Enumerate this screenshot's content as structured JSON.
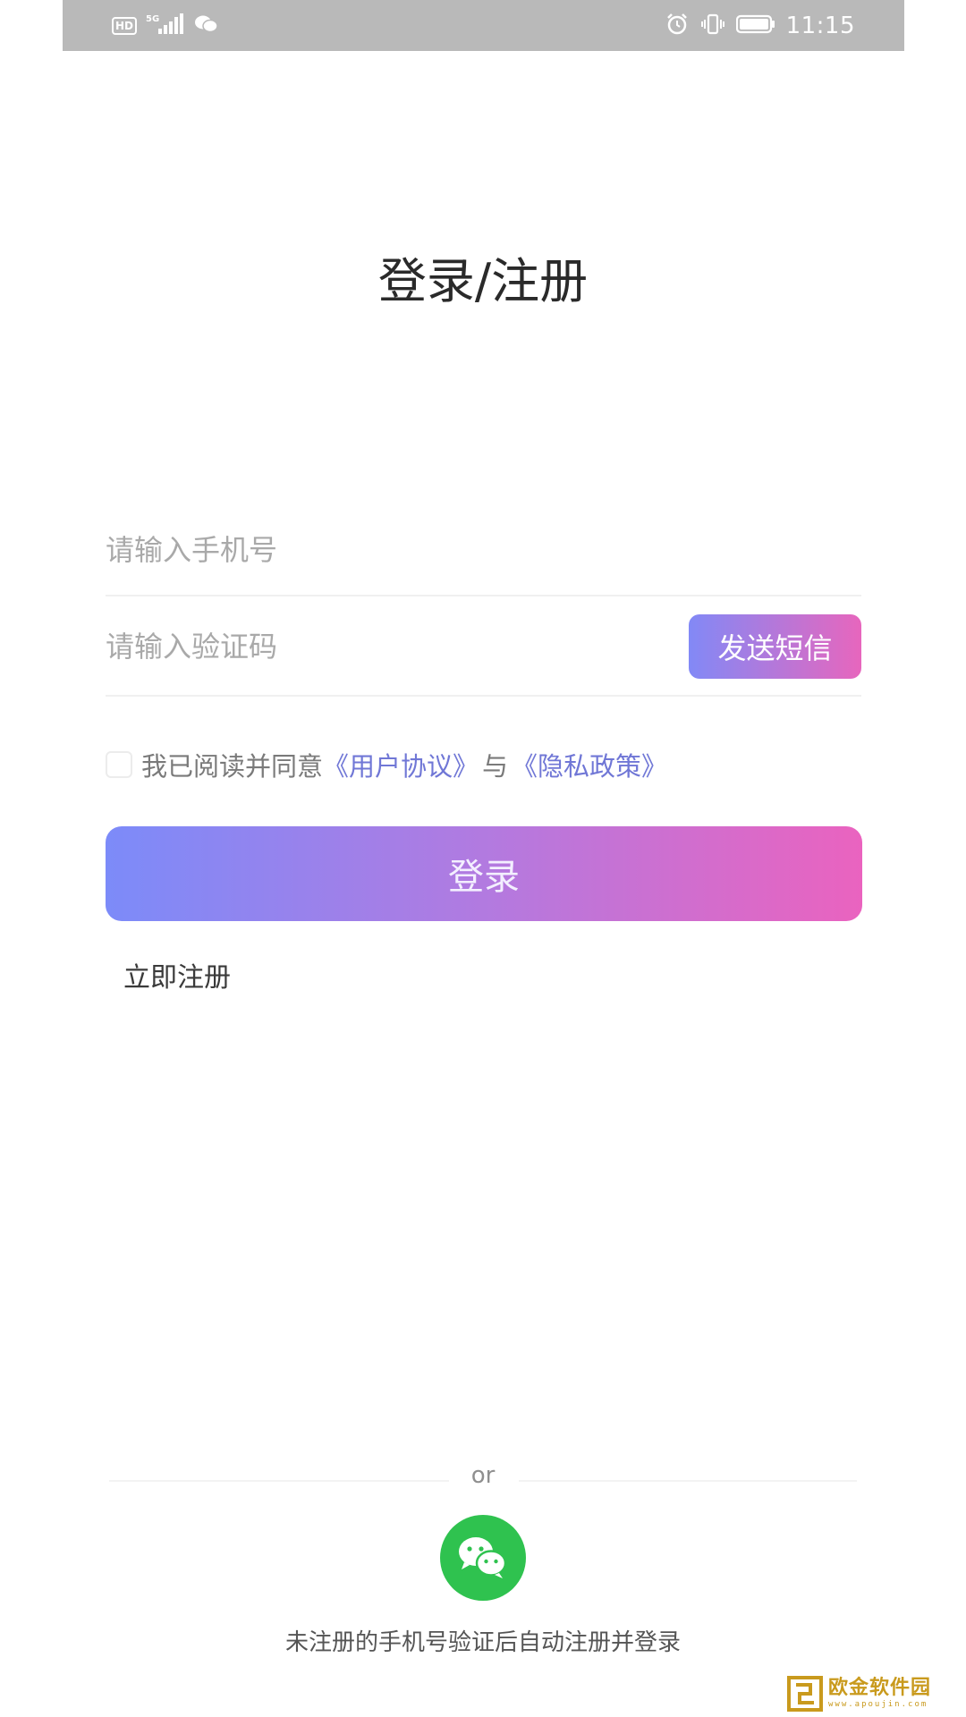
{
  "status_bar": {
    "hd_label": "HD",
    "network_label": "5G",
    "time": "11:15",
    "icons": [
      "hd-icon",
      "signal-icon",
      "wechat-notification-icon",
      "alarm-icon",
      "vibrate-icon",
      "battery-icon"
    ]
  },
  "title": "登录/注册",
  "phone_input": {
    "placeholder": "请输入手机号",
    "value": ""
  },
  "code_input": {
    "placeholder": "请输入验证码",
    "value": ""
  },
  "sms_button_label": "发送短信",
  "agreement": {
    "checked": false,
    "prefix": "我已阅读并同意",
    "user_agreement_link": "《用户协议》",
    "conjunction": "与",
    "privacy_policy_link": "《隐私政策》"
  },
  "login_button_label": "登录",
  "register_link_label": "立即注册",
  "or_label": "or",
  "wechat_login": {
    "icon": "wechat-icon"
  },
  "footer_note": "未注册的手机号验证后自动注册并登录",
  "watermark": {
    "title": "欧金软件园",
    "url": "www.apoujin.com"
  },
  "colors": {
    "gradient_start": "#7c8bf9",
    "gradient_end": "#ea63bf",
    "link": "#7077d6",
    "wechat_green": "#2fc24f",
    "status_bar": "#b9b9b9"
  }
}
